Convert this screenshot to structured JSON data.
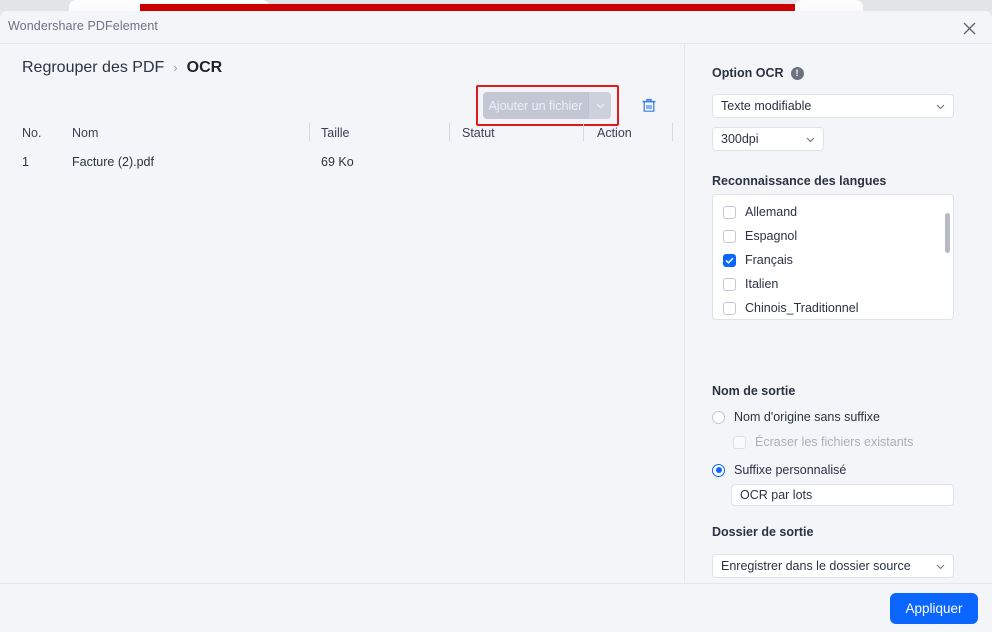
{
  "window": {
    "app_title": "Wondershare PDFelement",
    "close_icon": "close-icon",
    "accent_red": "#cc0000",
    "accent_blue": "#0a66ff"
  },
  "breadcrumb": {
    "root": "Regrouper des PDF",
    "separator": "›",
    "current": "OCR"
  },
  "toolbar": {
    "add_file_label": "Ajouter un fichier",
    "add_file_dropdown_icon": "chevron-down-icon",
    "delete_icon": "trash-icon",
    "highlight_color": "#e01b1b"
  },
  "table": {
    "columns": [
      "No.",
      "Nom",
      "Taille",
      "Statut",
      "Action"
    ],
    "rows": [
      {
        "no": "1",
        "nom": "Facture (2).pdf",
        "taille": "69 Ko",
        "statut": "",
        "action": ""
      }
    ]
  },
  "options": {
    "ocr_option": {
      "label": "Option OCR",
      "info_icon": "info-icon",
      "info_glyph": "!",
      "mode_value": "Texte modifiable",
      "dpi_value": "300dpi",
      "chevron_icon": "chevron-down-icon"
    },
    "languages": {
      "label": "Reconnaissance des langues",
      "items": [
        {
          "label": "Allemand",
          "checked": false
        },
        {
          "label": "Espagnol",
          "checked": false
        },
        {
          "label": "Français",
          "checked": true
        },
        {
          "label": "Italien",
          "checked": false
        },
        {
          "label": "Chinois_Traditionnel",
          "checked": false
        }
      ],
      "scrollbar": "vertical-scrollbar"
    },
    "output_name": {
      "label": "Nom de sortie",
      "origin_option": "Nom d'origine sans suffixe",
      "origin_selected": false,
      "overwrite_option": "Écraser les fichiers existants",
      "overwrite_checked": false,
      "overwrite_disabled": true,
      "suffix_option": "Suffixe personnalisé",
      "suffix_selected": true,
      "suffix_value": "OCR par lots"
    },
    "output_folder": {
      "label": "Dossier de sortie",
      "value": "Enregistrer dans le dossier source",
      "chevron_icon": "chevron-down-icon"
    }
  },
  "footer": {
    "apply_label": "Appliquer"
  }
}
